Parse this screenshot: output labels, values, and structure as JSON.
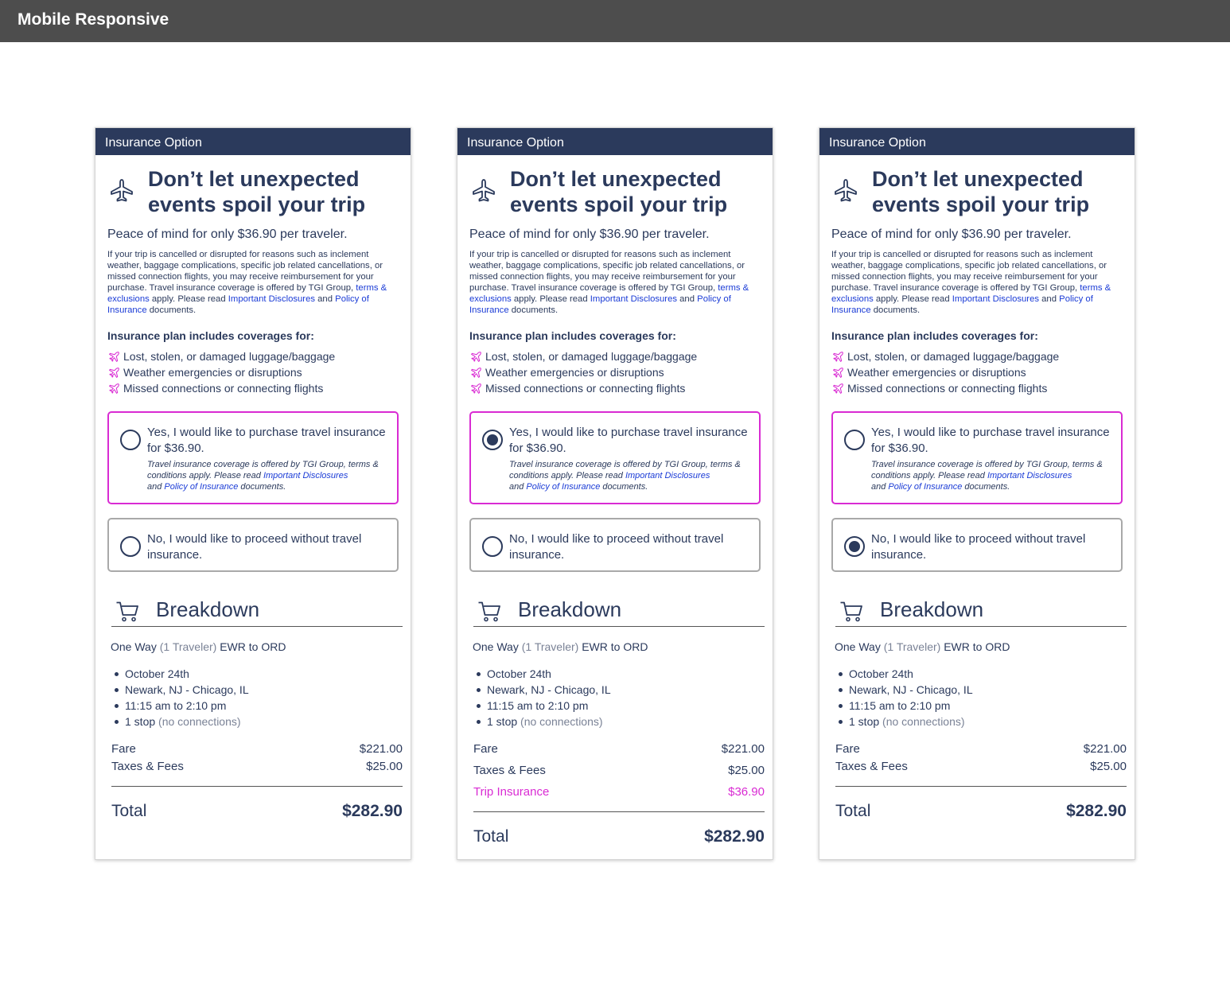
{
  "page_title": "Mobile Responsive",
  "colors": {
    "navy": "#2b3a5c",
    "accent_pink": "#d92bd3",
    "link_blue": "#1a3bd6",
    "topbar": "#4d4d4d"
  },
  "card": {
    "header": "Insurance Option",
    "headline": "Don’t let unexpected events spoil your trip",
    "subhead": "Peace of mind for only $36.90 per traveler.",
    "body_1": "If your trip is cancelled or disrupted for reasons such as inclement weather, baggage complications, specific job related cancellations, or missed connection flights, you may receive reimbursement for your purchase. Travel insurance coverage is offered by TGI Group, ",
    "link_terms": "terms & exclusions",
    "body_2": " apply. Please read ",
    "link_disclosures": "Important Disclosures",
    "body_and": " and ",
    "link_policy": "Policy of Insurance",
    "body_end": " documents.",
    "coverage_title": "Insurance plan includes coverages for:",
    "coverages": [
      "Lost, stolen, or damaged luggage/baggage",
      "Weather emergencies or disruptions",
      "Missed connections or connecting flights"
    ],
    "option_yes": "Yes, I would like to purchase travel insurance for $36.90.",
    "option_yes_fine_1": "Travel insurance coverage is offered by TGI Group, terms & conditions apply. Please read ",
    "option_yes_fine_link1": "Important Disclosures",
    "option_yes_fine_and": " and ",
    "option_yes_fine_link2": "Policy of Insurance",
    "option_yes_fine_end": " documents.",
    "option_no": "No, I would like to proceed without travel insurance.",
    "breakdown_title": "Breakdown",
    "trip_type": "One Way",
    "travelers": "(1 Traveler)",
    "route": "EWR to ORD",
    "details": {
      "date": "October 24th",
      "cities": "Newark, NJ - Chicago, IL",
      "time": "11:15 am to 2:10 pm",
      "stops": "1 stop",
      "stops_note": "(no connections)"
    },
    "fare_label": "Fare",
    "fare_value": "$221.00",
    "taxes_label": "Taxes & Fees",
    "taxes_value": "$25.00",
    "insurance_label": "Trip Insurance",
    "insurance_value": "$36.90",
    "total_label": "Total",
    "total_value": "$282.90"
  },
  "states": [
    {
      "selected": "none"
    },
    {
      "selected": "yes"
    },
    {
      "selected": "no"
    }
  ]
}
